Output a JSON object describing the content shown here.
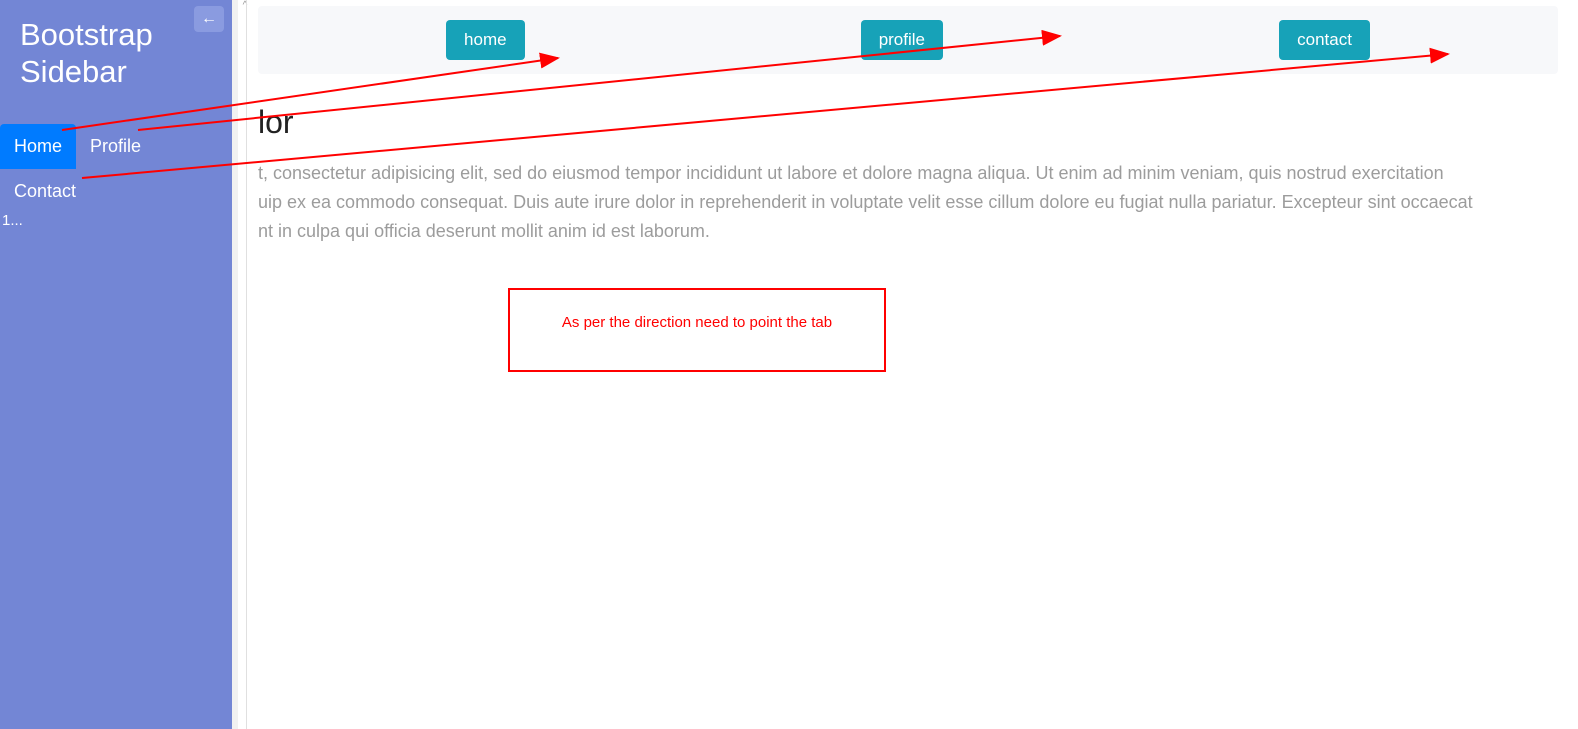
{
  "sidebar": {
    "title": "Bootstrap Sidebar",
    "collapse_icon": "←",
    "nav": {
      "home": "Home",
      "profile": "Profile",
      "contact": "Contact"
    },
    "footer": "1..."
  },
  "topbar": {
    "tabs": {
      "home": "home",
      "profile": "profile",
      "contact": "contact"
    }
  },
  "content": {
    "heading_fragment": "lor",
    "paragraph_line1": "t, consectetur adipisicing elit, sed do eiusmod tempor incididunt ut labore et dolore magna aliqua. Ut enim ad minim veniam, quis nostrud exercitation",
    "paragraph_line2": "uip ex ea commodo consequat. Duis aute irure dolor in reprehenderit in voluptate velit esse cillum dolore eu fugiat nulla pariatur. Excepteur sint occaecat",
    "paragraph_line3": "nt in culpa qui officia deserunt mollit anim id est laborum."
  },
  "annotation": {
    "text": "As per the direction need to point the tab"
  }
}
